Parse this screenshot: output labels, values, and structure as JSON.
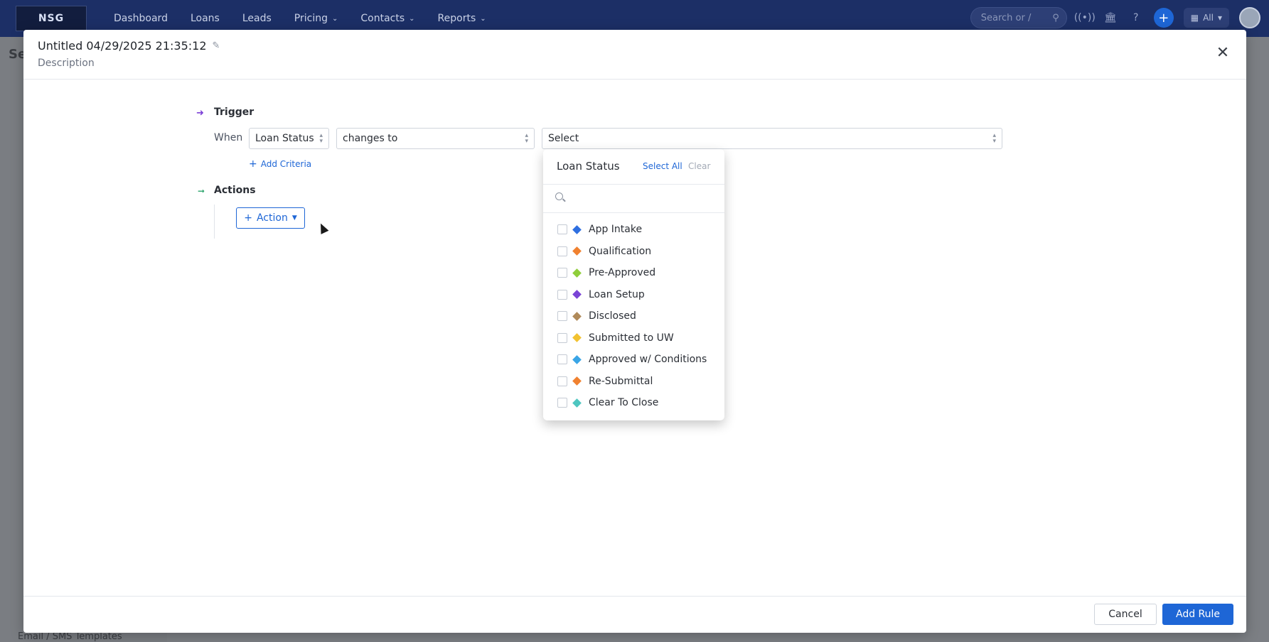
{
  "topnav": {
    "logo": "NSG",
    "links": [
      {
        "label": "Dashboard",
        "dropdown": false
      },
      {
        "label": "Loans",
        "dropdown": false
      },
      {
        "label": "Leads",
        "dropdown": false
      },
      {
        "label": "Pricing",
        "dropdown": true
      },
      {
        "label": "Contacts",
        "dropdown": true
      },
      {
        "label": "Reports",
        "dropdown": true
      }
    ],
    "search_placeholder": "Search or /",
    "all_label": "All"
  },
  "background": {
    "page_title_partial": "Se",
    "footer_text": "Email / SMS Templates"
  },
  "modal": {
    "title": "Untitled 04/29/2025 21:35:12",
    "description": "Description",
    "trigger": {
      "label": "Trigger",
      "when_label": "When",
      "field": "Loan Status",
      "operator": "changes to",
      "value_placeholder": "Select",
      "add_criteria": "Add Criteria"
    },
    "actions": {
      "label": "Actions",
      "button": "Action"
    },
    "footer": {
      "cancel": "Cancel",
      "add_rule": "Add Rule"
    }
  },
  "dropdown": {
    "title": "Loan Status",
    "select_all": "Select All",
    "clear": "Clear",
    "items": [
      {
        "label": "App Intake",
        "color": "#2f6fe0"
      },
      {
        "label": "Qualification",
        "color": "#f0812f"
      },
      {
        "label": "Pre-Approved",
        "color": "#8fce3a"
      },
      {
        "label": "Loan Setup",
        "color": "#7a44d6"
      },
      {
        "label": "Disclosed",
        "color": "#b08a5a"
      },
      {
        "label": "Submitted to UW",
        "color": "#f2c230"
      },
      {
        "label": "Approved w/ Conditions",
        "color": "#3aa5e6"
      },
      {
        "label": "Re-Submittal",
        "color": "#f0812f"
      },
      {
        "label": "Clear To Close",
        "color": "#4ec6c0"
      }
    ]
  }
}
